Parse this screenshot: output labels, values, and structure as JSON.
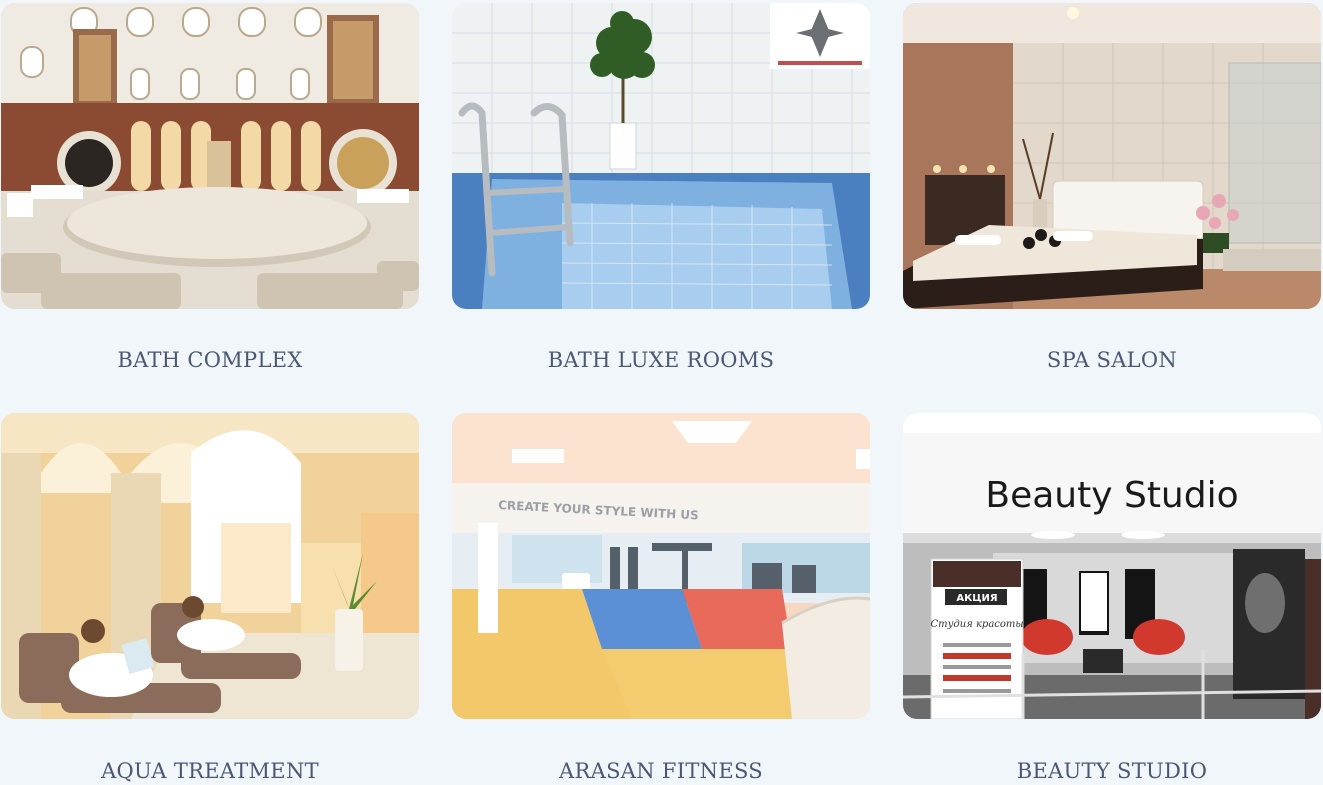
{
  "services": [
    {
      "id": "bath-complex",
      "title": "BATH COMPLEX"
    },
    {
      "id": "bath-luxe-rooms",
      "title": "BATH LUXE ROOMS"
    },
    {
      "id": "spa-salon",
      "title": "SPA SALON"
    },
    {
      "id": "aqua-treatment",
      "title": "AQUA TREATMENT"
    },
    {
      "id": "arasan-fitness",
      "title": "ARASAN FITNESS"
    },
    {
      "id": "beauty-studio",
      "title": "BEAUTY STUDIO"
    }
  ],
  "photo_text": {
    "fitness_wall": "CREATE YOUR STYLE  WITH US",
    "beauty_sign": "Beauty Studio",
    "beauty_poster_head": "АКЦИЯ",
    "beauty_poster_title": "Студия красоты"
  },
  "colors": {
    "background": "#f1f6fb",
    "caption": "#4b5773"
  }
}
